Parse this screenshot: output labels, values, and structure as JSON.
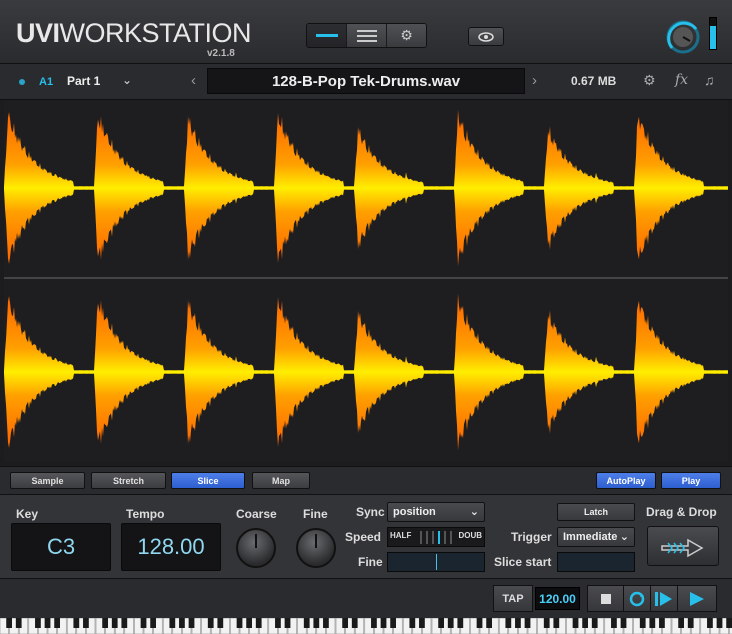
{
  "header": {
    "logo_bold": "UVI",
    "logo_rest": "WORKSTATION",
    "version": "v2.1.8",
    "view_buttons": [
      "single-line-view-icon",
      "list-view-icon",
      "gear-icon"
    ],
    "eye_icon": "eye-icon",
    "meter_level": 0.75,
    "accent_color": "#27c0ea"
  },
  "part": {
    "id": "A1",
    "name": "Part 1",
    "filename": "128-B-Pop Tek-Drums.wav",
    "size": "0.67 MB",
    "icons": [
      "settings-icon",
      "fx-icon",
      "note-icon"
    ]
  },
  "tabs": {
    "sample": "Sample",
    "stretch": "Stretch",
    "slice": "Slice",
    "map": "Map",
    "autoplay": "AutoPlay",
    "play": "Play",
    "selected": "Slice"
  },
  "controls": {
    "key_label": "Key",
    "key_value": "C3",
    "tempo_label": "Tempo",
    "tempo_value": "128.00",
    "coarse_label": "Coarse",
    "fine_label": "Fine",
    "sync_label": "Sync",
    "sync_value": "position",
    "speed_label": "Speed",
    "speed_half": "HALF",
    "speed_double": "DOUB",
    "fine2_label": "Fine",
    "fine2_level": 0.5,
    "latch": "Latch",
    "trigger_label": "Trigger",
    "trigger_value": "Immediate",
    "slice_start_label": "Slice start",
    "drag_label": "Drag & Drop"
  },
  "transport": {
    "tap": "TAP",
    "tempo": "120.00",
    "icons": [
      "stop-icon",
      "loop-icon",
      "play-from-start-icon",
      "play-icon"
    ]
  }
}
